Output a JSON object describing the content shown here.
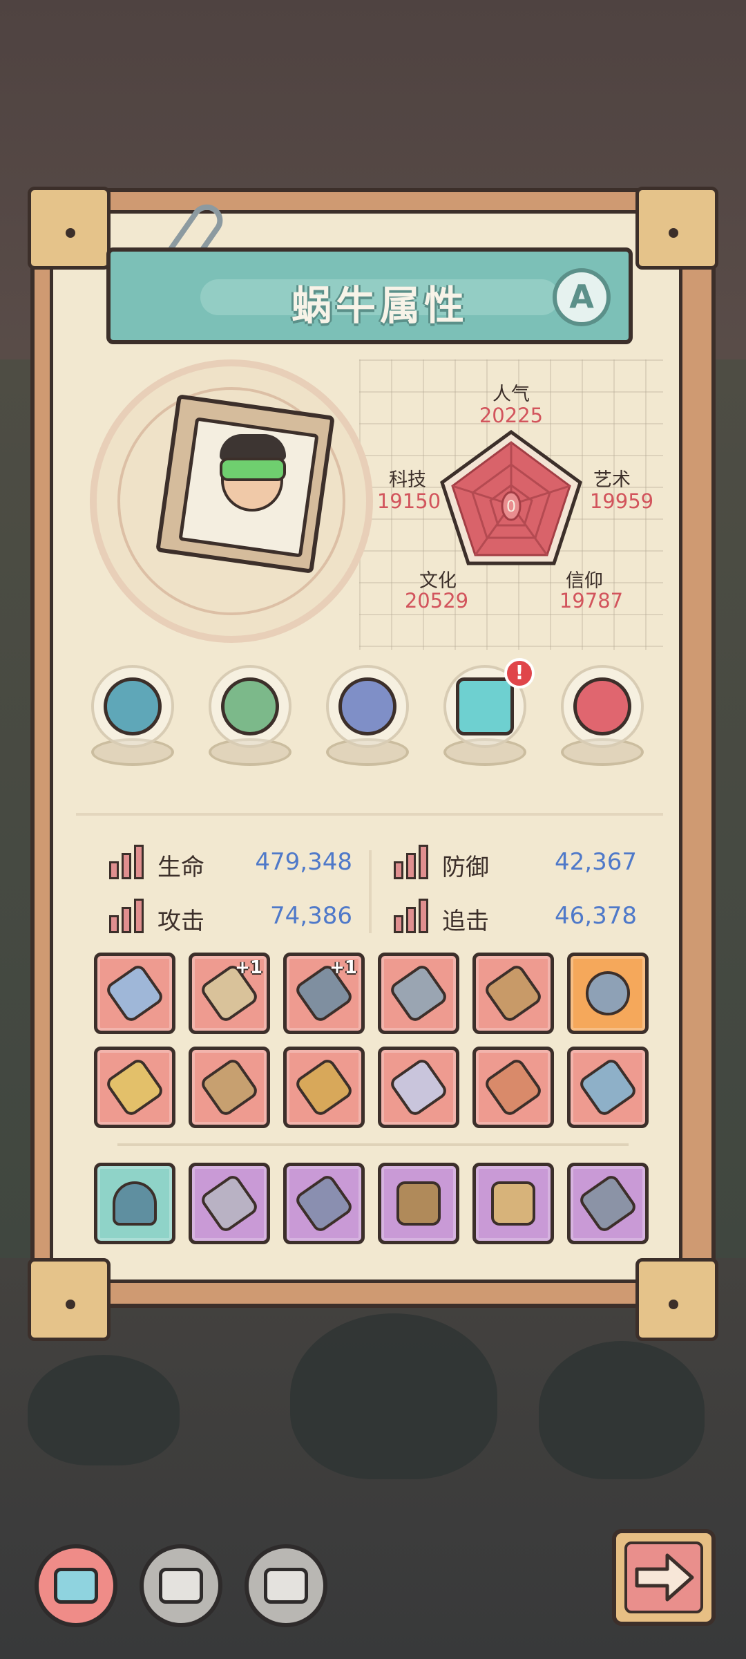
{
  "title": "蜗牛属性",
  "grade": "A",
  "radar": {
    "center_label": "0",
    "stats": [
      {
        "key": "popularity",
        "label": "人气",
        "value": "20225"
      },
      {
        "key": "art",
        "label": "艺术",
        "value": "19959"
      },
      {
        "key": "faith",
        "label": "信仰",
        "value": "19787"
      },
      {
        "key": "culture",
        "label": "文化",
        "value": "20529"
      },
      {
        "key": "tech",
        "label": "科技",
        "value": "19150"
      }
    ]
  },
  "relics": [
    {
      "name": "relic-1",
      "color": "#5fa7b8",
      "alert": false
    },
    {
      "name": "relic-2",
      "color": "#7cb98a",
      "alert": false
    },
    {
      "name": "relic-3",
      "color": "#7f8fc7",
      "alert": false
    },
    {
      "name": "relic-4",
      "color": "#6ed0d0",
      "alert": true,
      "alert_text": "!"
    },
    {
      "name": "relic-5",
      "color": "#e0666f",
      "alert": false
    }
  ],
  "attributes": {
    "hp": {
      "label": "生命",
      "value": "479,348"
    },
    "defense": {
      "label": "防御",
      "value": "42,367"
    },
    "attack": {
      "label": "攻击",
      "value": "74,386"
    },
    "chase": {
      "label": "追击",
      "value": "46,378"
    }
  },
  "equipment_rows": [
    [
      {
        "icon": "sword-icon",
        "bg": "red",
        "plus": ""
      },
      {
        "icon": "gauntlet-icon",
        "bg": "red",
        "plus": "+1"
      },
      {
        "icon": "bracer-icon",
        "bg": "red",
        "plus": "+1"
      },
      {
        "icon": "dagger-icon",
        "bg": "red",
        "plus": ""
      },
      {
        "icon": "crossbow-icon",
        "bg": "red",
        "plus": ""
      },
      {
        "icon": "hook-icon",
        "bg": "gold",
        "plus": ""
      }
    ],
    [
      {
        "icon": "axe-icon",
        "bg": "red",
        "plus": ""
      },
      {
        "icon": "blaster-icon",
        "bg": "red",
        "plus": ""
      },
      {
        "icon": "mace-icon",
        "bg": "red",
        "plus": ""
      },
      {
        "icon": "spear-icon",
        "bg": "red",
        "plus": ""
      },
      {
        "icon": "rocket-icon",
        "bg": "red",
        "plus": ""
      },
      {
        "icon": "gun-icon",
        "bg": "red",
        "plus": ""
      }
    ],
    [
      {
        "icon": "helmet-icon",
        "bg": "teal",
        "plus": ""
      },
      {
        "icon": "katana-icon",
        "bg": "purple",
        "plus": ""
      },
      {
        "icon": "glove-icon",
        "bg": "purple",
        "plus": ""
      },
      {
        "icon": "armor-icon",
        "bg": "purple",
        "plus": ""
      },
      {
        "icon": "chest-icon",
        "bg": "purple",
        "plus": ""
      },
      {
        "icon": "staff-icon",
        "bg": "purple",
        "plus": ""
      }
    ]
  ],
  "bottom_nav": [
    {
      "name": "snail-tab-1",
      "active": true
    },
    {
      "name": "snail-tab-2",
      "active": false
    },
    {
      "name": "snail-tab-3",
      "active": false
    }
  ],
  "colors": {
    "accent_red": "#d2545c",
    "value_blue": "#4f79c9",
    "title_teal": "#7cc0b7"
  }
}
